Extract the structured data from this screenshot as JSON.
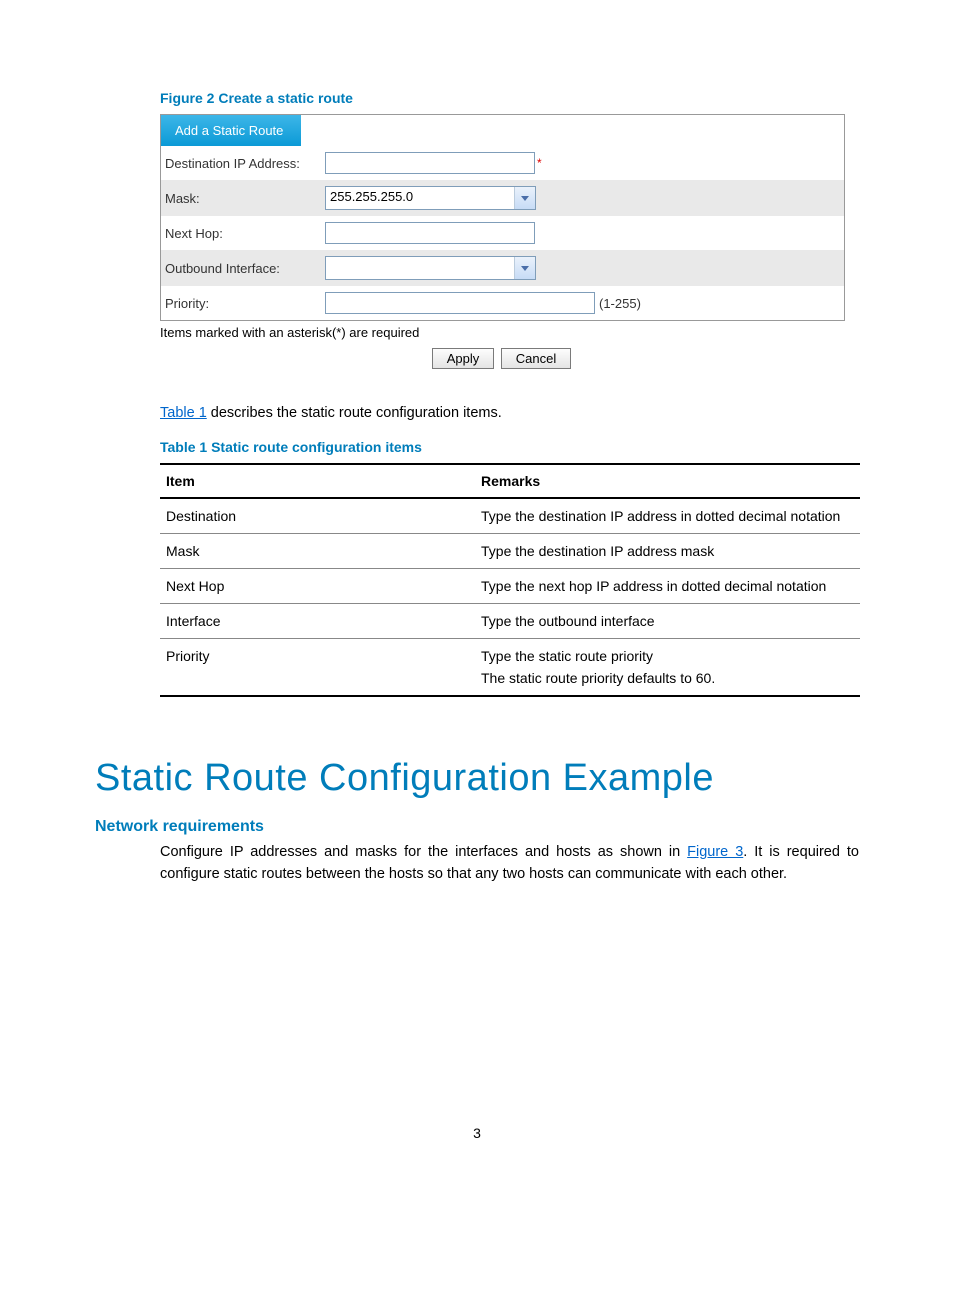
{
  "figure2": {
    "caption": "Figure 2 Create a static route",
    "tab": "Add a Static Route",
    "fields": {
      "dest_label": "Destination IP Address:",
      "mask_label": "Mask:",
      "mask_value": "255.255.255.0",
      "nexthop_label": "Next Hop:",
      "outif_label": "Outbound Interface:",
      "priority_label": "Priority:",
      "priority_hint": "(1-255)"
    },
    "required_note": "Items marked with an asterisk(*) are required",
    "apply": "Apply",
    "cancel": "Cancel"
  },
  "para1_pre": "",
  "para1_link": "Table 1",
  "para1_post": " describes the static route configuration items.",
  "table1": {
    "caption": "Table 1 Static route configuration items",
    "h1": "Item",
    "h2": "Remarks",
    "rows": [
      {
        "item": "Destination",
        "remarks": "Type the destination IP address in dotted decimal notation"
      },
      {
        "item": "Mask",
        "remarks": "Type the destination IP address mask"
      },
      {
        "item": "Next Hop",
        "remarks": "Type the next hop IP address in dotted decimal notation"
      },
      {
        "item": "Interface",
        "remarks": "Type the outbound interface"
      }
    ],
    "priority_item": "Priority",
    "priority_r1": "Type the static route priority",
    "priority_r2": "The static route priority defaults to 60."
  },
  "heading": "Static Route Configuration Example",
  "subheading": "Network requirements",
  "para2_pre": "Configure IP addresses and masks for the interfaces and hosts as shown in ",
  "para2_link": "Figure 3",
  "para2_post": ". It is required to configure static routes between the hosts so that any two hosts can communicate with each other.",
  "page_number": "3"
}
